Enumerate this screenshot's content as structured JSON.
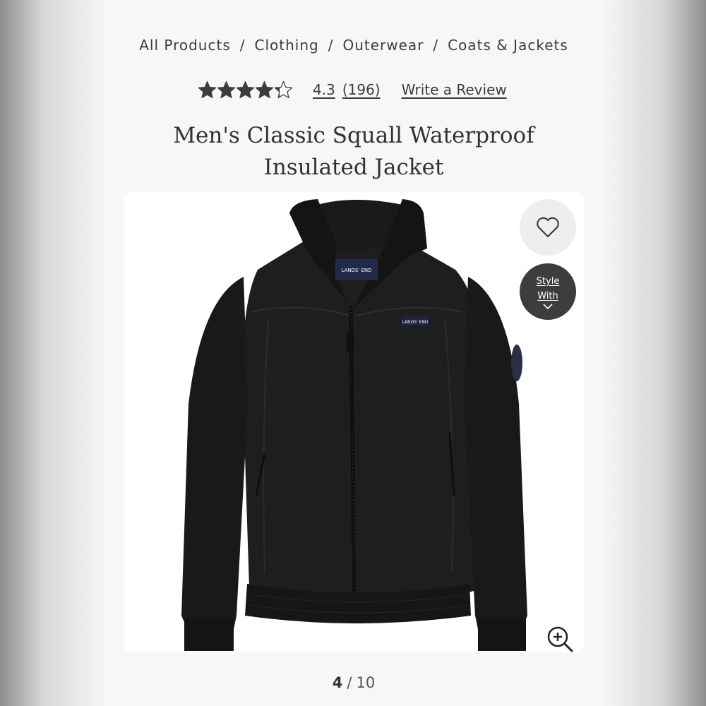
{
  "breadcrumb": {
    "items": [
      "All Products",
      "Clothing",
      "Outerwear",
      "Coats & Jackets"
    ],
    "separator": "/"
  },
  "rating": {
    "stars": 4.3,
    "max_stars": 5,
    "value_text": "4.3",
    "count_text": "(196)",
    "write_review": "Write a Review"
  },
  "product": {
    "title": "Men's Classic Squall Waterproof Insulated Jacket",
    "brand_label": "LANDS' END"
  },
  "image_actions": {
    "favorite_icon": "heart-icon",
    "style_with": [
      "Style",
      "With"
    ],
    "style_with_icon": "chevron-down-icon",
    "zoom_icon": "zoom-in-icon"
  },
  "pager": {
    "current": "4",
    "separator": "/",
    "total": "10"
  },
  "colors": {
    "accent_dark": "#3d3d3d",
    "text": "#3c3c3c",
    "panel_bg": "#f8f7f5",
    "star": "#3c3c3c"
  }
}
